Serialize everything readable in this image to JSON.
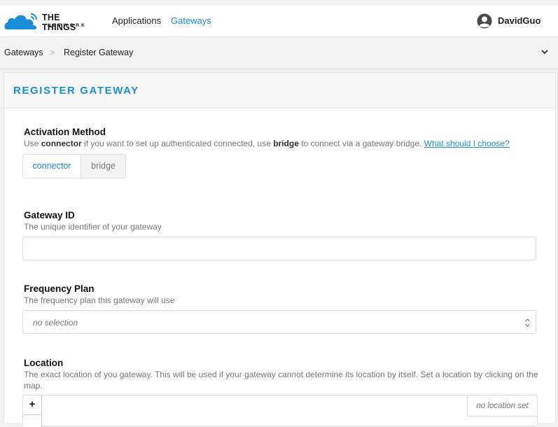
{
  "brand": {
    "line1": "THE THINGS",
    "line2": "NETWORK",
    "accent": "#1b8dd6"
  },
  "nav": {
    "items": [
      {
        "label": "Applications",
        "active": false
      },
      {
        "label": "Gateways",
        "active": true
      }
    ]
  },
  "user": {
    "name": "DavidGuo",
    "icon": "user-avatar-icon"
  },
  "breadcrumb": {
    "items": [
      "Gateways",
      "Register Gateway"
    ],
    "separator": ">",
    "toggle_icon": "chevron-down-icon"
  },
  "card": {
    "title": "REGISTER GATEWAY"
  },
  "activation": {
    "label": "Activation Method",
    "desc_parts": [
      "Use ",
      "connector",
      " if you want to set up authenticated connected, use ",
      "bridge",
      " to connect via a gateway bridge. "
    ],
    "help_link": "What should I choose?",
    "options": [
      "connector",
      "bridge"
    ],
    "selected": "connector"
  },
  "gateway_id": {
    "label": "Gateway ID",
    "desc": "The unique identifier of your gateway",
    "value": ""
  },
  "frequency_plan": {
    "label": "Frequency Plan",
    "desc": "The frequency plan this gateway will use",
    "selected": "no selection"
  },
  "location": {
    "label": "Location",
    "desc": "The exact location of you gateway. This will be used if your gateway cannot determine its location by itself. Set a location by clicking on the map.",
    "zoom_in": "+",
    "status": "no location set"
  }
}
